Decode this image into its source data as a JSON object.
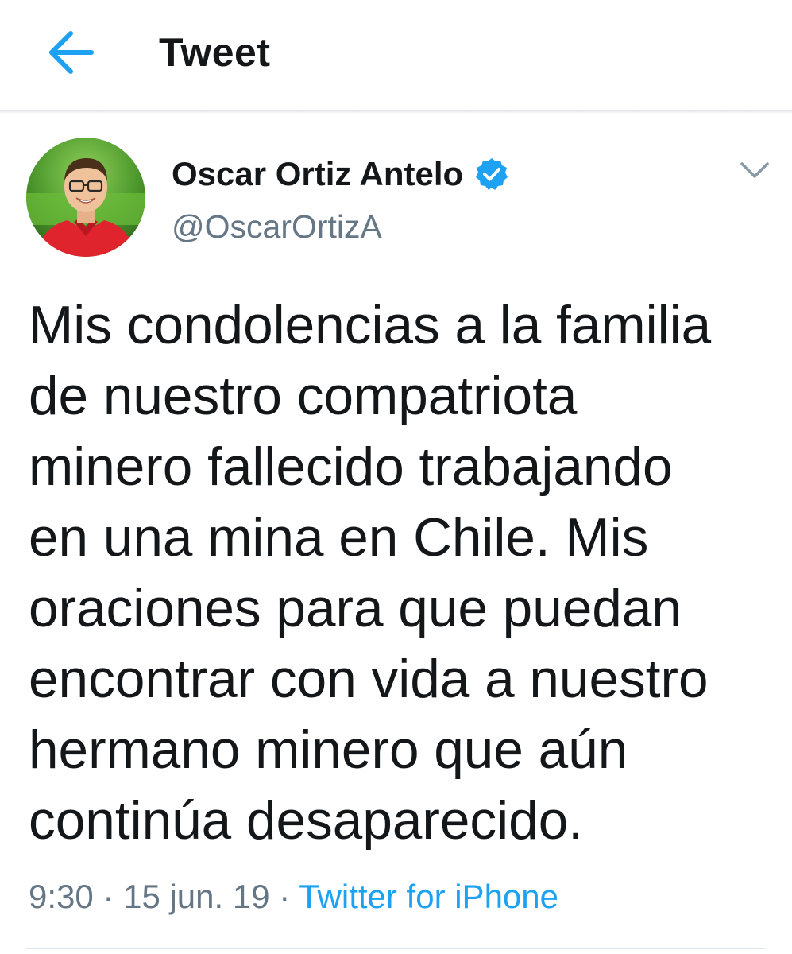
{
  "header": {
    "title": "Tweet",
    "back_icon": "arrow-left-icon",
    "accent": "#1da1f2"
  },
  "author": {
    "display_name": "Oscar Ortiz Antelo",
    "handle": "@OscarOrtizA",
    "verified": true,
    "verified_icon": "verified-badge-icon",
    "verified_color": "#1da1f2"
  },
  "menu": {
    "caret_icon": "chevron-down-icon"
  },
  "tweet": {
    "text": "Mis condolencias a la familia\nde nuestro compatriota\nminero fallecido trabajando\nen una mina en Chile. Mis\noraciones para que puedan\nencontrar con vida a nuestro\nhermano minero que aún\ncontinúa desaparecido.",
    "time": "9:30",
    "date": "15 jun. 19",
    "separator": "·",
    "source": "Twitter for iPhone"
  },
  "colors": {
    "text_primary": "#14171a",
    "text_secondary": "#657786",
    "link": "#1da1f2",
    "divider": "#e1e8ed"
  }
}
